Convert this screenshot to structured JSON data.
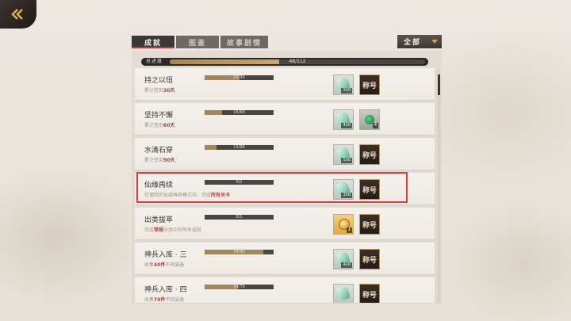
{
  "tabs": [
    {
      "label": "成就",
      "active": true
    },
    {
      "label": "图鉴",
      "active": false
    },
    {
      "label": "故事剧情",
      "active": false
    }
  ],
  "filter": {
    "label": "全部"
  },
  "total_progress": {
    "label": "总进度",
    "value_text": "48/112",
    "fraction": 0.4286
  },
  "achievements": [
    {
      "name": "持之以恒",
      "desc_pre": "累计签到",
      "desc_hl": "30天",
      "desc_post": "",
      "progress_text": "15/30",
      "fraction": 0.5,
      "rewards": [
        {
          "icon": "jade-gem-icon",
          "count": "300"
        }
      ],
      "title_btn": "称号"
    },
    {
      "name": "坚持不懈",
      "desc_pre": "累计签到",
      "desc_hl": "60天",
      "desc_post": "",
      "progress_text": "15/60",
      "fraction": 0.25,
      "rewards": [
        {
          "icon": "jade-gem-icon",
          "count": "400"
        },
        {
          "icon": "green-orb-icon",
          "count": "4"
        }
      ],
      "title_btn": ""
    },
    {
      "name": "水滴石穿",
      "desc_pre": "累计签到",
      "desc_hl": "90天",
      "desc_post": "",
      "progress_text": "15/90",
      "fraction": 0.1667,
      "rewards": [
        {
          "icon": "jade-gem-icon",
          "count": "500"
        }
      ],
      "title_btn": "称号"
    },
    {
      "name": "仙缘再续",
      "desc_pre": "在冒险的仙缘再续模式中，完成",
      "desc_hl": "所有关卡",
      "desc_post": "",
      "progress_text": "0/1",
      "fraction": 0,
      "rewards": [
        {
          "icon": "jade-gem-icon",
          "count": "300"
        }
      ],
      "title_btn": "称号"
    },
    {
      "name": "出类拔萃",
      "desc_pre": "完成",
      "desc_hl": "常规",
      "desc_post": "分类中的所有成就",
      "progress_text": "0/1",
      "fraction": 0,
      "rewards": [
        {
          "icon": "gold-coin-icon",
          "count": "1"
        }
      ],
      "title_btn": "称号"
    },
    {
      "name": "神兵入库 · 三",
      "desc_pre": "收集",
      "desc_hl": "40件",
      "desc_post": "不同装备",
      "progress_text": "34/40",
      "fraction": 0.85,
      "rewards": [
        {
          "icon": "jade-gem-icon",
          "count": "400"
        }
      ],
      "title_btn": "称号"
    },
    {
      "name": "神兵入库 · 四",
      "desc_pre": "收集",
      "desc_hl": "70件",
      "desc_post": "不同装备",
      "progress_text": "34/70",
      "fraction": 0.4857,
      "rewards": [
        {
          "icon": "jade-gem-icon",
          "count": ""
        }
      ],
      "title_btn": "称号"
    }
  ]
}
